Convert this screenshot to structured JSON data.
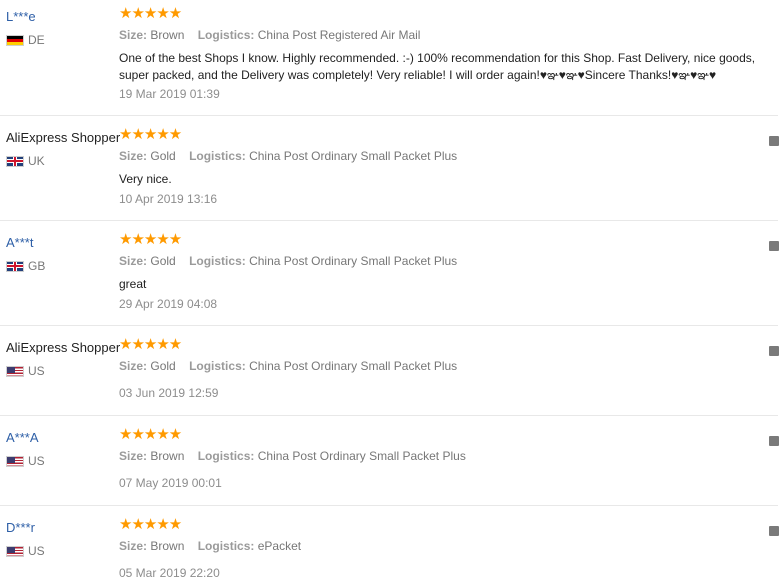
{
  "labels": {
    "size": "Size:",
    "logistics": "Logistics:"
  },
  "colors": {
    "star": "#ff9a00",
    "masked_user": "#2e5fa7",
    "flag_button": "#7a7a7a"
  },
  "reviews": [
    {
      "user": "L***e",
      "country": "DE",
      "flag": "germany-flag-icon",
      "stars": "★★★★★",
      "rating": 5,
      "size": "Brown",
      "logistics": "China Post Registered Air Mail",
      "feedback": "One of the best Shops I know. Highly recommended. :-) 100% recommendation for this Shop. Fast Delivery, nice goods, super packed, and the Delivery was completely! Very reliable! I will order again!♥ఞ♥ఞ♥Sincere Thanks!♥ఞ♥ఞ♥",
      "date": "19 Mar 2019 01:39"
    },
    {
      "user": "AliExpress Shopper",
      "country": "UK",
      "flag": "uk-flag-icon",
      "stars": "★★★★★",
      "rating": 5,
      "size": "Gold",
      "logistics": "China Post Ordinary Small Packet Plus",
      "feedback": "Very nice.",
      "date": "10 Apr 2019 13:16"
    },
    {
      "user": "A***t",
      "country": "GB",
      "flag": "uk-flag-icon",
      "stars": "★★★★★",
      "rating": 5,
      "size": "Gold",
      "logistics": "China Post Ordinary Small Packet Plus",
      "feedback": "great",
      "date": "29 Apr 2019 04:08"
    },
    {
      "user": "AliExpress Shopper",
      "country": "US",
      "flag": "us-flag-icon",
      "stars": "★★★★★",
      "rating": 5,
      "size": "Gold",
      "logistics": "China Post Ordinary Small Packet Plus",
      "feedback": "",
      "date": "03 Jun 2019 12:59"
    },
    {
      "user": "A***A",
      "country": "US",
      "flag": "us-flag-icon",
      "stars": "★★★★★",
      "rating": 5,
      "size": "Brown",
      "logistics": "China Post Ordinary Small Packet Plus",
      "feedback": "",
      "date": "07 May 2019 00:01"
    },
    {
      "user": "D***r",
      "country": "US",
      "flag": "us-flag-icon",
      "stars": "★★★★★",
      "rating": 5,
      "size": "Brown",
      "logistics": "ePacket",
      "feedback": "",
      "date": "05 Mar 2019 22:20"
    }
  ]
}
